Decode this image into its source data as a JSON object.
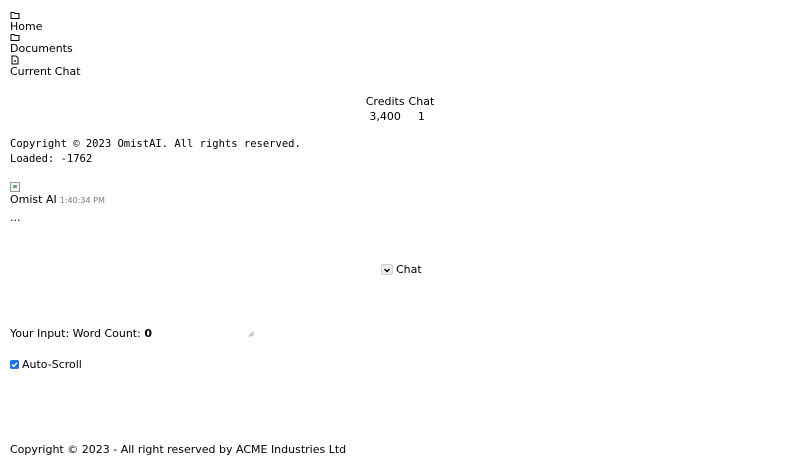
{
  "nav": {
    "items": [
      {
        "label": "Home",
        "icon": "folder-icon"
      },
      {
        "label": "Documents",
        "icon": "folder-icon"
      },
      {
        "label": "Current Chat",
        "icon": "file-icon"
      }
    ]
  },
  "stats": {
    "headers": [
      "Credits",
      "Chat"
    ],
    "values": [
      "3,400",
      "1"
    ]
  },
  "info": {
    "copyright": "Copyright © 2023 OmistAI. All rights reserved.",
    "loaded": "Loaded: -1762"
  },
  "message": {
    "author": "Omist AI",
    "time": "1:40:34 PM",
    "body": "..."
  },
  "mode_select": {
    "selected": "Chat"
  },
  "input": {
    "label": "Your Input:",
    "word_count_label": "Word Count:",
    "word_count": "0"
  },
  "auto_scroll": {
    "label": "Auto-Scroll",
    "checked": true
  },
  "footer": {
    "text": "Copyright © 2023 - All right reserved by ACME Industries Ltd"
  }
}
